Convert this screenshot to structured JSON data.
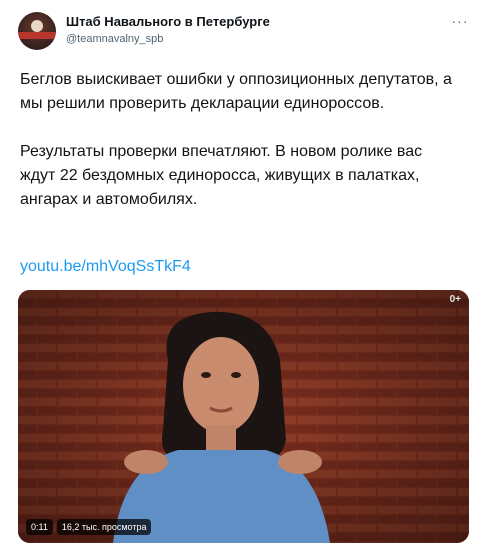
{
  "account": {
    "name": "Штаб Навального в Петербурге",
    "handle": "@teamnavalny_spb",
    "avatar_icon": "avatar-logo"
  },
  "menu_icon": "more-dots-icon",
  "tweet": {
    "paragraph_1": "Беглов выискивает ошибки у оппозиционных депутатов, а мы решили проверить декларации единороссов.",
    "paragraph_2": "Результаты проверки впечатляют. В новом ролике вас ждут 22 бездомных единоросса, живущих в палатках, ангарах и автомобилях.",
    "link": "youtu.be/mhVoqSsTkF4"
  },
  "video": {
    "age_rating": "0+",
    "duration": "0:11",
    "views": "16,2 тыс. просмотра"
  },
  "colors": {
    "text": "#0f1419",
    "secondary": "#536471",
    "link": "#1d9bf0",
    "brick": "#7a2b1c"
  }
}
